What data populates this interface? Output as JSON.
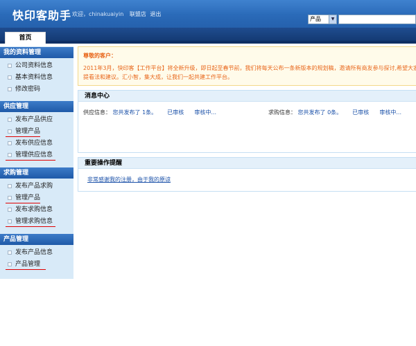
{
  "header": {
    "title": "快印客助手",
    "welcome": "欢迎，chinakuaiyin",
    "alliance_link": "联盟店",
    "logout_link": "退出",
    "search_select_value": "产品",
    "search_placeholder": ""
  },
  "tabs": [
    {
      "label": "首页",
      "active": true
    }
  ],
  "sidebar": {
    "sections": [
      {
        "title": "我的资料管理",
        "items": [
          "公司资料信息",
          "基本资料信息",
          "修改密码"
        ]
      },
      {
        "title": "供应管理",
        "items": [
          "发布产品供应",
          "管理产品",
          "发布供应信息",
          "管理供应信息"
        ]
      },
      {
        "title": "求购管理",
        "items": [
          "发布产品求购",
          "管理产品",
          "发布求购信息",
          "管理求购信息"
        ]
      },
      {
        "title": "产品管理",
        "items": [
          "发布产品信息",
          "产品管理"
        ]
      }
    ]
  },
  "notice": {
    "title": "尊敬的客户：",
    "body": "2011年3月，快印客【工作平台】将全新升级，即日起至春节前，我们将每天公布一条新版本的规划稿，邀请所有商友参与探讨,希望大家多提看法和建议。汇小智，集大成，让我们一起共建工作平台。"
  },
  "message_center": {
    "title": "消息中心",
    "supply": {
      "label": "供应信息：",
      "count_text": "您共发布了 1条。",
      "approved": "已审核",
      "pending": "审核中..."
    },
    "purchase": {
      "label": "求购信息：",
      "count_text": "您共发布了 0条。",
      "approved": "已审核",
      "pending": "审核中..."
    }
  },
  "reminders": {
    "title": "重要操作提醒",
    "link": "非常感谢我的注册，由于我的原谅"
  },
  "colors": {
    "header_blue": "#2a6ab8",
    "tabbar_navy": "#143a73",
    "sidebar_bg": "#d8eaf8",
    "notice_text": "#e8661a",
    "link_blue": "#1a50a8",
    "marker_red": "#e00000"
  }
}
